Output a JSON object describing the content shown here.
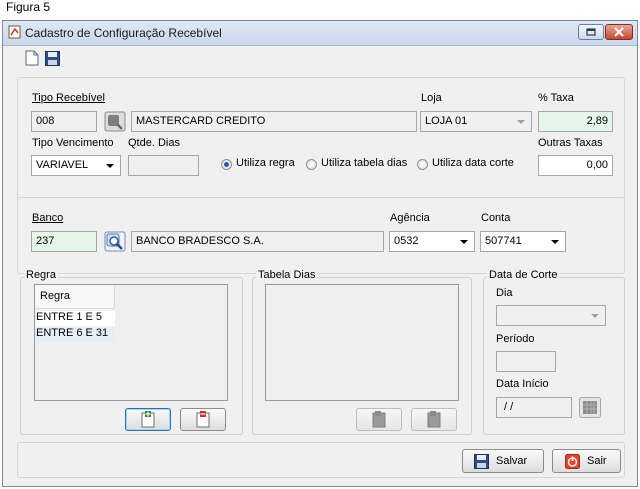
{
  "caption": "Figura 5",
  "window": {
    "title": "Cadastro de Configuração Recebível"
  },
  "recebivel": {
    "tipo_label": "Tipo Recebível",
    "tipo_code": "008",
    "tipo_desc": "MASTERCARD CREDITO",
    "loja_label": "Loja",
    "loja_value": "LOJA 01",
    "taxa_label": "% Taxa",
    "taxa_value": "2,89",
    "vencimento_label": "Tipo Vencimento",
    "vencimento_value": "VARIAVEL",
    "qtde_label": "Qtde. Dias",
    "qtde_value": "",
    "radio_regra": "Utiliza regra",
    "radio_tabela": "Utiliza tabela dias",
    "radio_corte": "Utiliza data corte",
    "radio_selected": "Utiliza regra",
    "outras_label": "Outras Taxas",
    "outras_value": "0,00"
  },
  "banco": {
    "label": "Banco",
    "code": "237",
    "name": "BANCO BRADESCO S.A.",
    "agencia_label": "Agência",
    "agencia_value": "0532",
    "conta_label": "Conta",
    "conta_value": "507741"
  },
  "regra": {
    "group_label": "Regra",
    "column_header": "Regra",
    "rows": [
      "ENTRE 1 E 5",
      "ENTRE 6 E 31"
    ]
  },
  "tabela_dias": {
    "group_label": "Tabela Dias"
  },
  "data_corte": {
    "group_label": "Data de Corte",
    "dia_label": "Dia",
    "dia_value": "",
    "periodo_label": "Período",
    "periodo_value": "",
    "inicio_label": "Data Início",
    "inicio_value": " / /"
  },
  "footer": {
    "save_label": "Salvar",
    "exit_label": "Sair"
  },
  "colors": {
    "accent": "#2a5ba8",
    "green_field": "#e6f7ea",
    "close_red": "#c4472f"
  }
}
